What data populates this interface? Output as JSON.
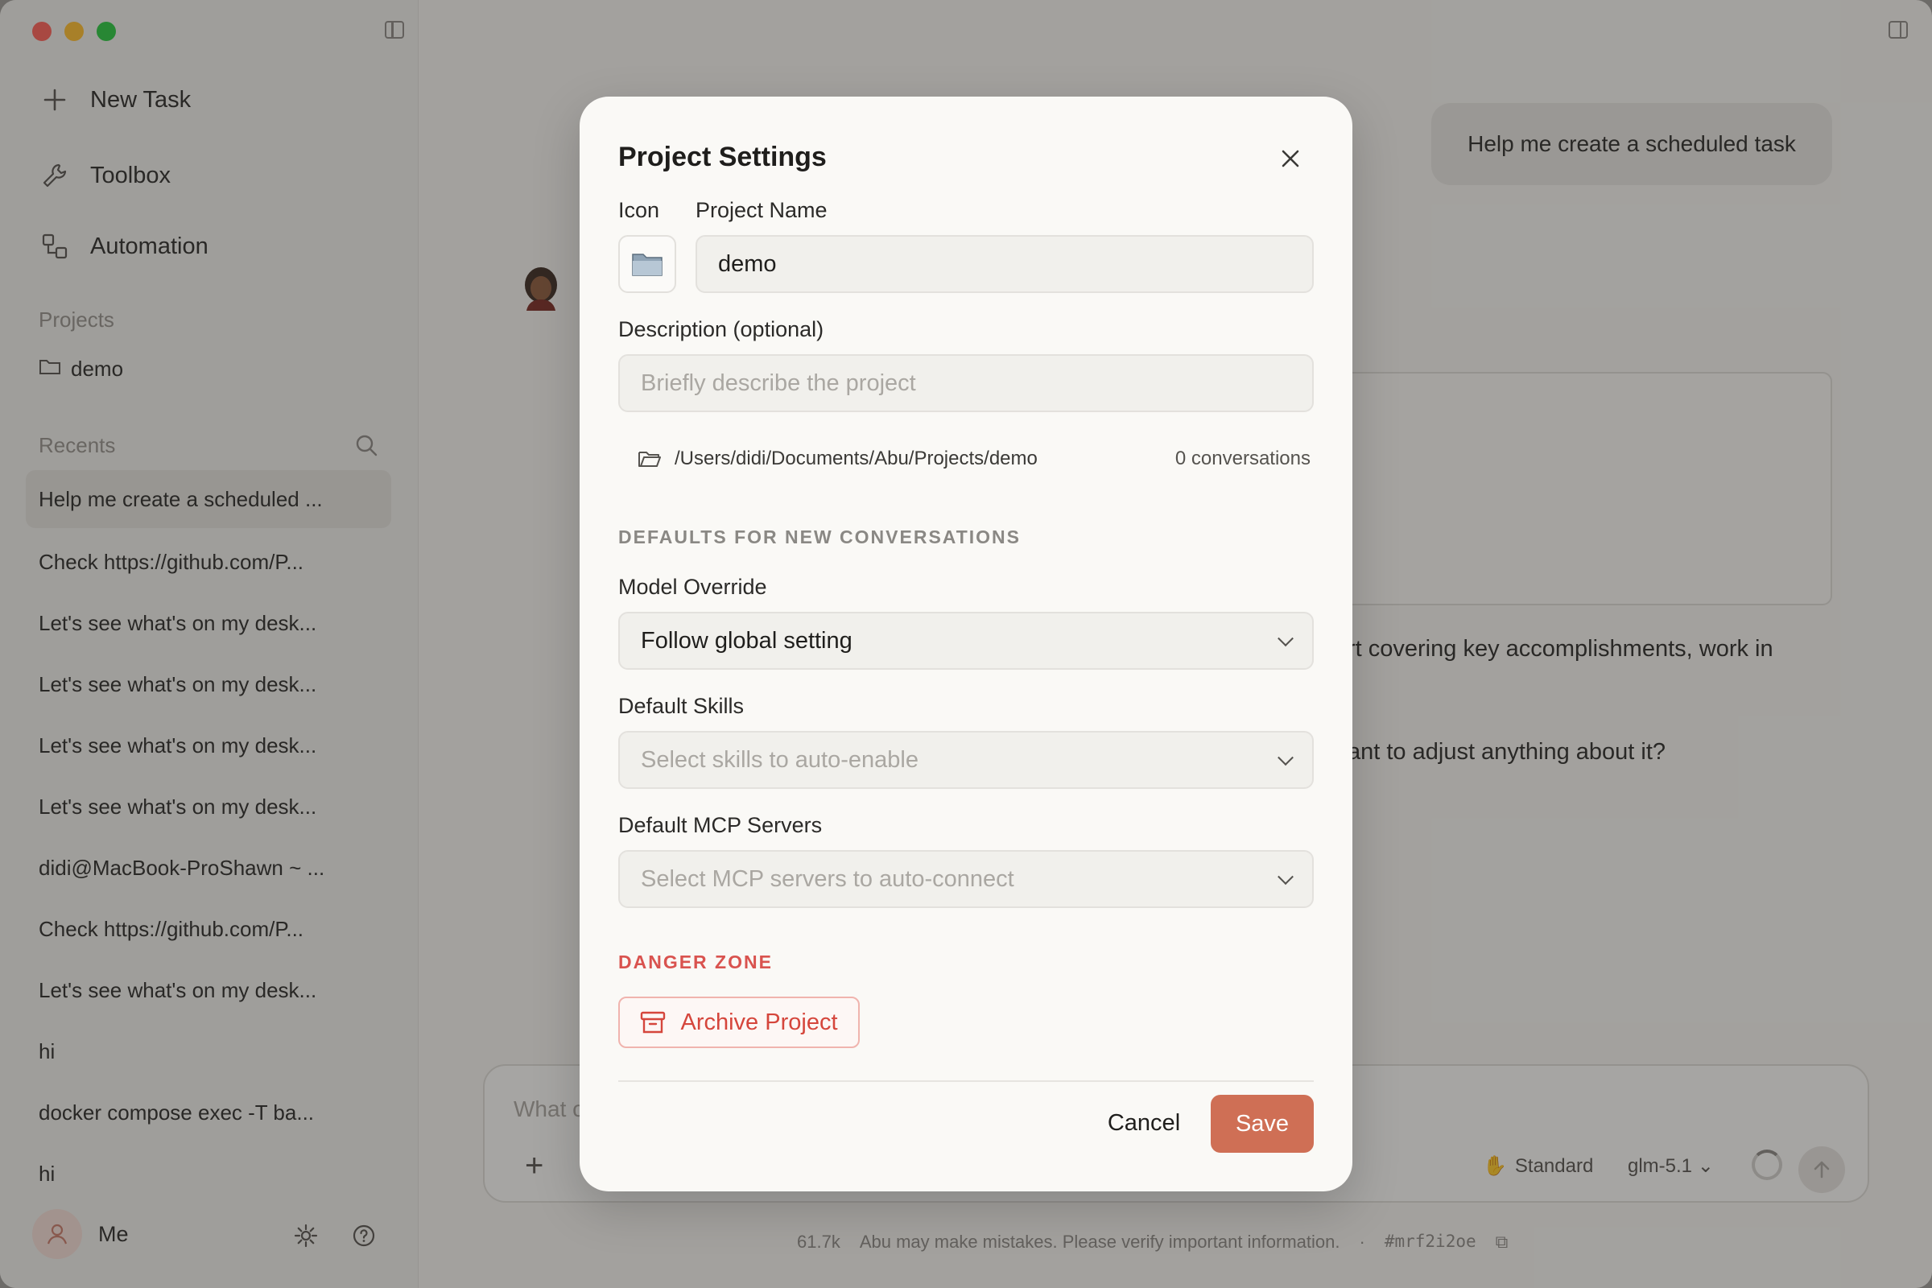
{
  "sidebar": {
    "nav": [
      {
        "label": "New Task",
        "icon": "plus-icon"
      },
      {
        "label": "Toolbox",
        "icon": "wrench-icon"
      },
      {
        "label": "Automation",
        "icon": "automation-icon"
      }
    ],
    "projects_heading": "Projects",
    "projects": [
      {
        "label": "demo",
        "icon": "folder-icon"
      }
    ],
    "recents_heading": "Recents",
    "recents": [
      "Help me create a scheduled ...",
      "Check https://github.com/P...",
      "Let's see what's on my desk...",
      "Let's see what's on my desk...",
      "Let's see what's on my desk...",
      "Let's see what's on my desk...",
      "didi@MacBook-ProShawn ~ ...",
      "Check https://github.com/P...",
      "Let's see what's on my desk...",
      "hi",
      "docker compose exec -T ba...",
      "hi"
    ],
    "user_name": "Me"
  },
  "chat": {
    "user_message": "Help me create a scheduled task",
    "line1": "rt covering key accomplishments, work in",
    "line2": "ant to adjust anything about it?",
    "composer_placeholder": "What c",
    "mode_label": "Standard",
    "model_label": "glm-5.1",
    "footer": {
      "tokens": "61.7k",
      "disclaimer": "Abu may make mistakes. Please verify important information.",
      "separator": "·",
      "session_id": "#mrf2i2oe"
    }
  },
  "modal": {
    "title": "Project Settings",
    "icon_label": "Icon",
    "name_label": "Project Name",
    "name_value": "demo",
    "description_label": "Description (optional)",
    "description_placeholder": "Briefly describe the project",
    "path": "/Users/didi/Documents/Abu/Projects/demo",
    "conversation_count": "0 conversations",
    "defaults_heading": "DEFAULTS FOR NEW CONVERSATIONS",
    "model_override_label": "Model Override",
    "model_override_value": "Follow global setting",
    "default_skills_label": "Default Skills",
    "default_skills_placeholder": "Select skills to auto-enable",
    "default_mcp_label": "Default MCP Servers",
    "default_mcp_placeholder": "Select MCP servers to auto-connect",
    "danger_heading": "DANGER ZONE",
    "archive_label": "Archive Project",
    "cancel_label": "Cancel",
    "save_label": "Save"
  },
  "colors": {
    "accent": "#cf6f55",
    "danger": "#d5463c"
  }
}
